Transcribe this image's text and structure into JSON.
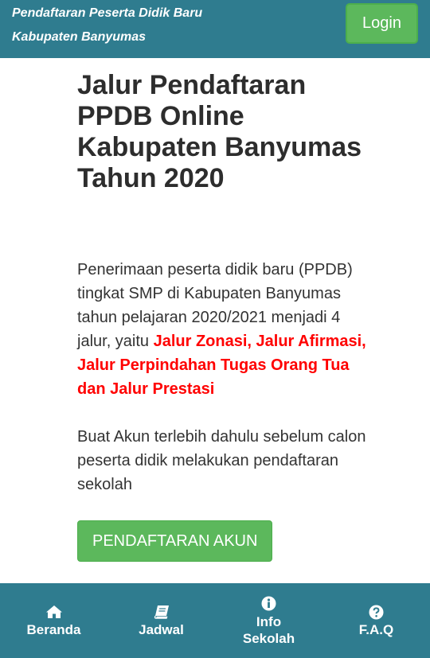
{
  "header": {
    "brand_line1": "Pendaftaran Peserta Didik Baru",
    "brand_line2": "Kabupaten Banyumas",
    "login_label": "Login"
  },
  "main": {
    "title": "Jalur Pendaftaran PPDB Online Kabupaten Banyumas Tahun 2020",
    "intro_text": "Penerimaan peserta didik baru (PPDB) tingkat SMP di Kabupaten Banyumas tahun pelajaran 2020/2021 menjadi 4 jalur, yaitu ",
    "intro_highlight": "Jalur Zonasi, Jalur Afirmasi, Jalur Perpindahan Tugas Orang Tua dan Jalur Prestasi",
    "note": "Buat Akun terlebih dahulu sebelum calon peserta didik melakukan pendaftaran sekolah",
    "register_label": "PENDAFTARAN AKUN"
  },
  "bottom_nav": {
    "items": [
      {
        "label": "Beranda",
        "icon": "home-icon"
      },
      {
        "label": "Jadwal",
        "icon": "book-icon"
      },
      {
        "label_line1": "Info",
        "label_line2": "Sekolah",
        "icon": "info-icon"
      },
      {
        "label": "F.A.Q",
        "icon": "question-icon"
      }
    ]
  },
  "colors": {
    "bar": "#2f7c8f",
    "button": "#5cb85c",
    "highlight": "#ff0000"
  }
}
